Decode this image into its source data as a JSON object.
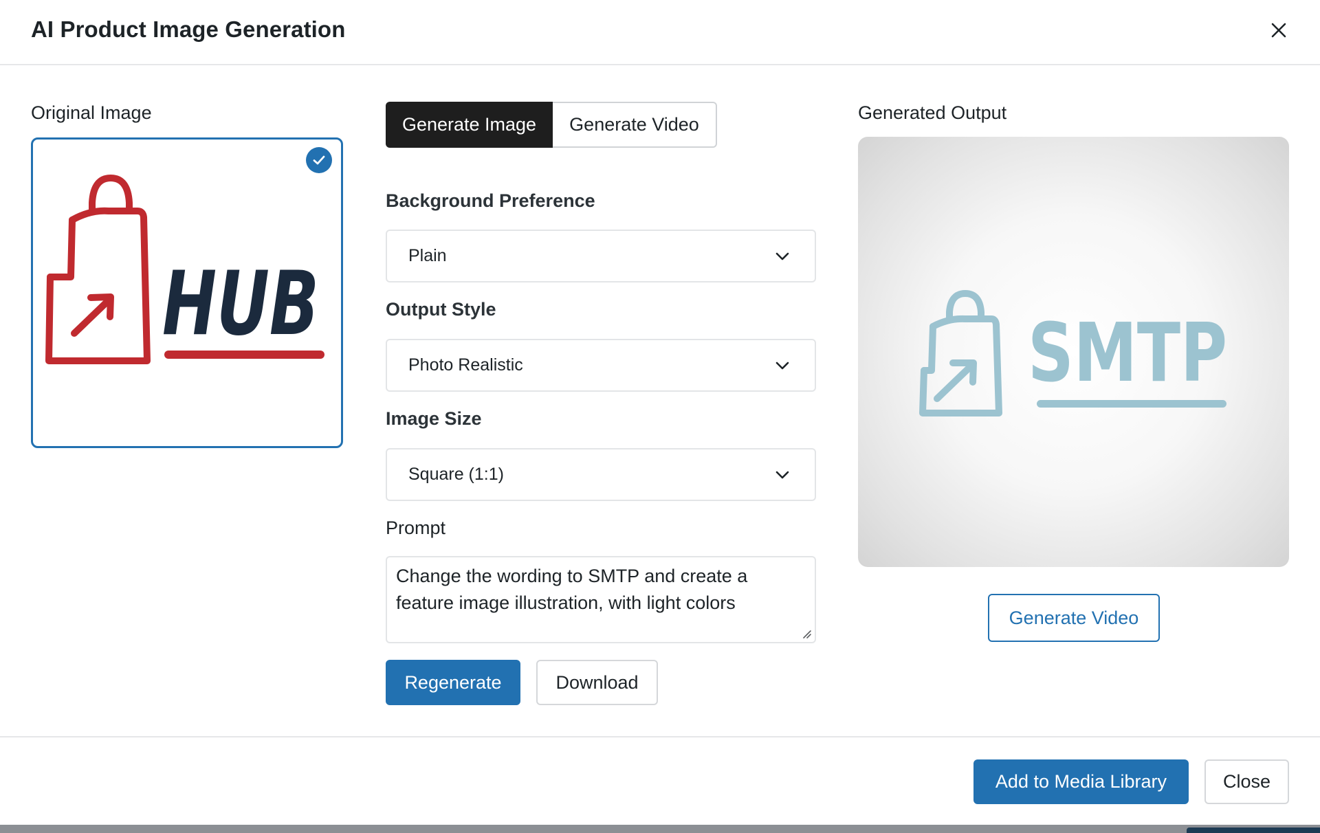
{
  "dialog": {
    "title": "AI Product Image Generation"
  },
  "original": {
    "label": "Original Image",
    "logo_text": "HUB"
  },
  "tabs": [
    {
      "label": "Generate Image",
      "active": true
    },
    {
      "label": "Generate Video",
      "active": false
    }
  ],
  "form": {
    "background": {
      "label": "Background Preference",
      "value": "Plain"
    },
    "style": {
      "label": "Output Style",
      "value": "Photo Realistic"
    },
    "size": {
      "label": "Image Size",
      "value": "Square (1:1)"
    },
    "prompt": {
      "label": "Prompt",
      "value": "Change the wording to SMTP and create a feature image illustration, with light colors"
    }
  },
  "actions": {
    "regenerate": "Regenerate",
    "download": "Download"
  },
  "output": {
    "label": "Generated Output",
    "logo_text": "SMTP",
    "generate_video": "Generate Video"
  },
  "footer": {
    "add_to_library": "Add to Media Library",
    "close": "Close"
  },
  "colors": {
    "accent": "#2271b1",
    "tab_active": "#1e1e1e",
    "hub_red": "#c02a2f",
    "hub_navy": "#1b2a3d",
    "smtp_teal": "#9cc3d0"
  },
  "icons": [
    "close-icon",
    "checkmark-icon",
    "chevron-down-icon",
    "resize-grip-icon",
    "shopping-bag-icon"
  ]
}
